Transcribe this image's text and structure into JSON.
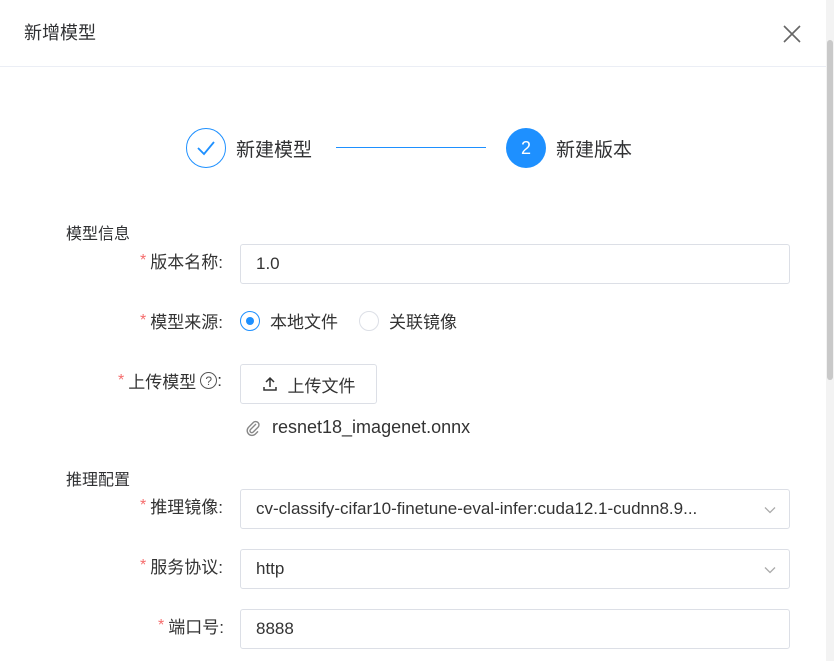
{
  "dialog": {
    "title": "新增模型"
  },
  "steps": [
    {
      "label": "新建模型",
      "icon": "check-icon"
    },
    {
      "number": "2",
      "label": "新建版本"
    }
  ],
  "sections": {
    "model_info": "模型信息",
    "inference_config": "推理配置"
  },
  "form": {
    "version_name": {
      "label": "版本名称:",
      "value": "1.0"
    },
    "model_source": {
      "label": "模型来源:",
      "options": [
        "本地文件",
        "关联镜像"
      ],
      "selected": "本地文件"
    },
    "upload_model": {
      "label": "上传模型",
      "help_icon": "?",
      "colon": ":",
      "button_label": "上传文件",
      "file_name": "resnet18_imagenet.onnx"
    },
    "inference_image": {
      "label": "推理镜像:",
      "value": "cv-classify-cifar10-finetune-eval-infer:cuda12.1-cudnn8.9..."
    },
    "service_protocol": {
      "label": "服务协议:",
      "value": "http"
    },
    "port": {
      "label": "端口号:",
      "value": "8888"
    },
    "required_mark": "*"
  },
  "colors": {
    "accent": "#1e90ff",
    "required": "#f56c6c",
    "border": "#dcdfe6"
  }
}
